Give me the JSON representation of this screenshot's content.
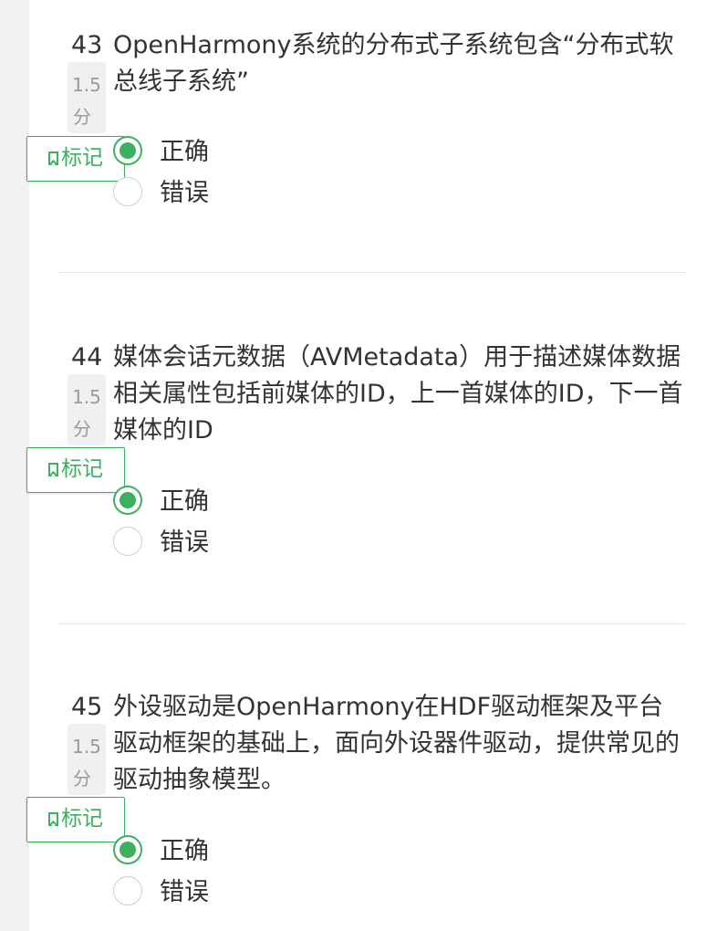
{
  "questions": [
    {
      "number": "43",
      "text": "OpenHarmony系统的分布式子系统包含“分布式软总线子系统”",
      "score": "1.5",
      "score_unit": "分",
      "mark_label": "标记",
      "options": [
        {
          "label": "正确",
          "selected": true
        },
        {
          "label": "错误",
          "selected": false
        }
      ]
    },
    {
      "number": "44",
      "text": "媒体会话元数据（AVMetadata）用于描述媒体数据相关属性包括前媒体的ID，上一首媒体的ID，下一首媒体的ID",
      "score": "1.5",
      "score_unit": "分",
      "mark_label": "标记",
      "options": [
        {
          "label": "正确",
          "selected": true
        },
        {
          "label": "错误",
          "selected": false
        }
      ]
    },
    {
      "number": "45",
      "text": "外设驱动是OpenHarmony在HDF驱动框架及平台驱动框架的基础上，面向外设器件驱动，提供常见的驱动抽象模型。",
      "score": "1.5",
      "score_unit": "分",
      "mark_label": "标记",
      "options": [
        {
          "label": "正确",
          "selected": true
        },
        {
          "label": "错误",
          "selected": false
        }
      ]
    }
  ],
  "colors": {
    "accent": "#3cb05f",
    "text": "#333333",
    "muted": "#9a9a9a",
    "divider": "#e3e3e3"
  }
}
